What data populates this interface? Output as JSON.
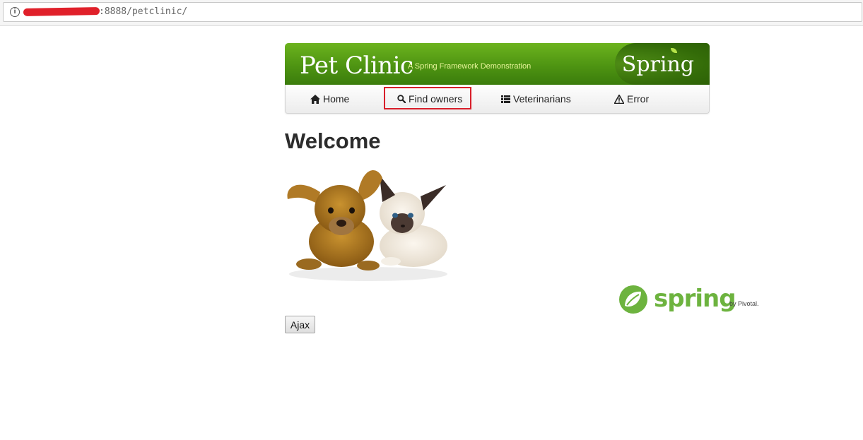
{
  "browser": {
    "url": ":8888/petclinic/"
  },
  "header": {
    "title": "Pet Clinic",
    "tagline": "A Spring Framework Demonstration",
    "brand": "Spring"
  },
  "nav": {
    "items": [
      {
        "label": "Home",
        "icon": "home-icon"
      },
      {
        "label": "Find owners",
        "icon": "search-icon"
      },
      {
        "label": "Veterinarians",
        "icon": "list-icon"
      },
      {
        "label": "Error",
        "icon": "warning-icon"
      }
    ],
    "highlighted": "Find owners"
  },
  "main": {
    "heading": "Welcome",
    "image": "pets-image",
    "ajax_button": "Ajax"
  },
  "footer_logo": {
    "word": "spring",
    "byline": "by Pivotal."
  },
  "colors": {
    "header_green": "#4e9412",
    "highlight_red": "#d81e2a",
    "spring_green": "#6db33f"
  }
}
